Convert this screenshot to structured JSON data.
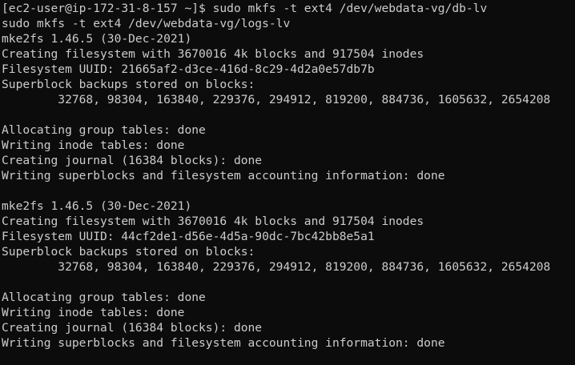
{
  "terminal": {
    "lines": [
      "[ec2-user@ip-172-31-8-157 ~]$ sudo mkfs -t ext4 /dev/webdata-vg/db-lv",
      "sudo mkfs -t ext4 /dev/webdata-vg/logs-lv",
      "mke2fs 1.46.5 (30-Dec-2021)",
      "Creating filesystem with 3670016 4k blocks and 917504 inodes",
      "Filesystem UUID: 21665af2-d3ce-416d-8c29-4d2a0e57db7b",
      "Superblock backups stored on blocks:",
      "        32768, 98304, 163840, 229376, 294912, 819200, 884736, 1605632, 2654208",
      "",
      "Allocating group tables: done",
      "Writing inode tables: done",
      "Creating journal (16384 blocks): done",
      "Writing superblocks and filesystem accounting information: done",
      "",
      "mke2fs 1.46.5 (30-Dec-2021)",
      "Creating filesystem with 3670016 4k blocks and 917504 inodes",
      "Filesystem UUID: 44cf2de1-d56e-4d5a-90dc-7bc42bb8e5a1",
      "Superblock backups stored on blocks:",
      "        32768, 98304, 163840, 229376, 294912, 819200, 884736, 1605632, 2654208",
      "",
      "Allocating group tables: done",
      "Writing inode tables: done",
      "Creating journal (16384 blocks): done",
      "Writing superblocks and filesystem accounting information: done"
    ]
  }
}
